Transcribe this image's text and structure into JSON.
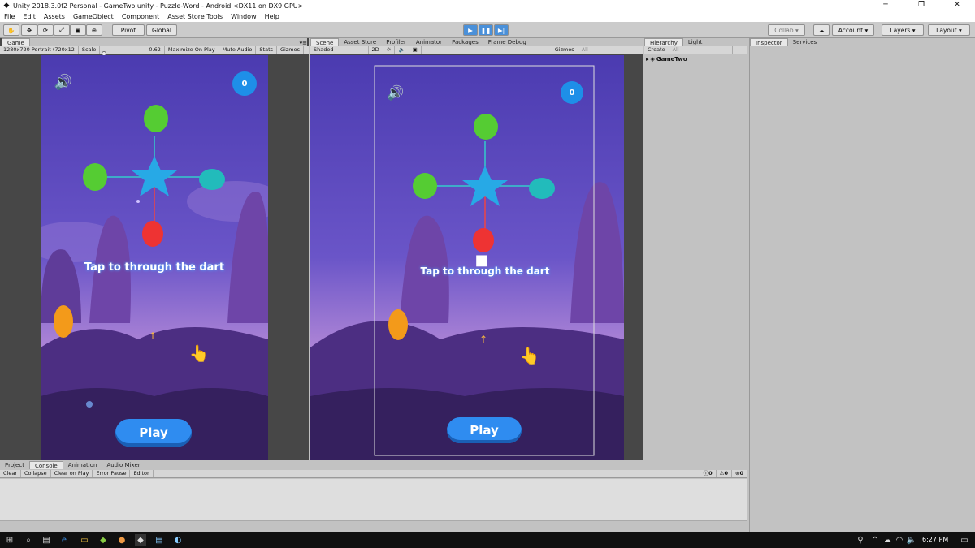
{
  "window": {
    "title": "Unity 2018.3.0f2 Personal - GameTwo.unity - Puzzle-Word - Android <DX11 on DX9 GPU>"
  },
  "menu": [
    "File",
    "Edit",
    "Assets",
    "GameObject",
    "Component",
    "Asset Store Tools",
    "Window",
    "Help"
  ],
  "toolbar": {
    "pivot": "Pivot",
    "global": "Global",
    "collab": "Collab",
    "account": "Account",
    "layers": "Layers",
    "layout": "Layout"
  },
  "game_panel": {
    "tab": "Game",
    "resolution": "1280x720 Portrait (720x12",
    "scale_label": "Scale",
    "scale_value": "0.62",
    "maximize": "Maximize On Play",
    "mute": "Mute Audio",
    "stats": "Stats",
    "gizmos": "Gizmos"
  },
  "scene_panel": {
    "tabs": [
      "Scene",
      "Asset Store",
      "Profiler",
      "Animator",
      "Packages",
      "Frame Debug"
    ],
    "shaded": "Shaded",
    "mode_2d": "2D",
    "gizmos": "Gizmos",
    "search_placeholder": "All"
  },
  "hierarchy": {
    "tabs": [
      "Hierarchy",
      "Light"
    ],
    "create": "Create",
    "search_placeholder": "All",
    "root": "GameTwo"
  },
  "inspector": {
    "tabs": [
      "Inspector",
      "Services"
    ]
  },
  "bottom": {
    "tabs": [
      "Project",
      "Console",
      "Animation",
      "Audio Mixer"
    ],
    "buttons": [
      "Clear",
      "Collapse",
      "Clear on Play",
      "Error Pause",
      "Editor"
    ],
    "counts": [
      "0",
      "0",
      "0"
    ]
  },
  "game": {
    "score": "0",
    "instruction": "Tap to through the dart",
    "play_label": "Play"
  },
  "taskbar": {
    "time": "6:27 PM"
  },
  "colors": {
    "accent": "#3a8ee6",
    "editor_bg": "#c2c2c2"
  }
}
